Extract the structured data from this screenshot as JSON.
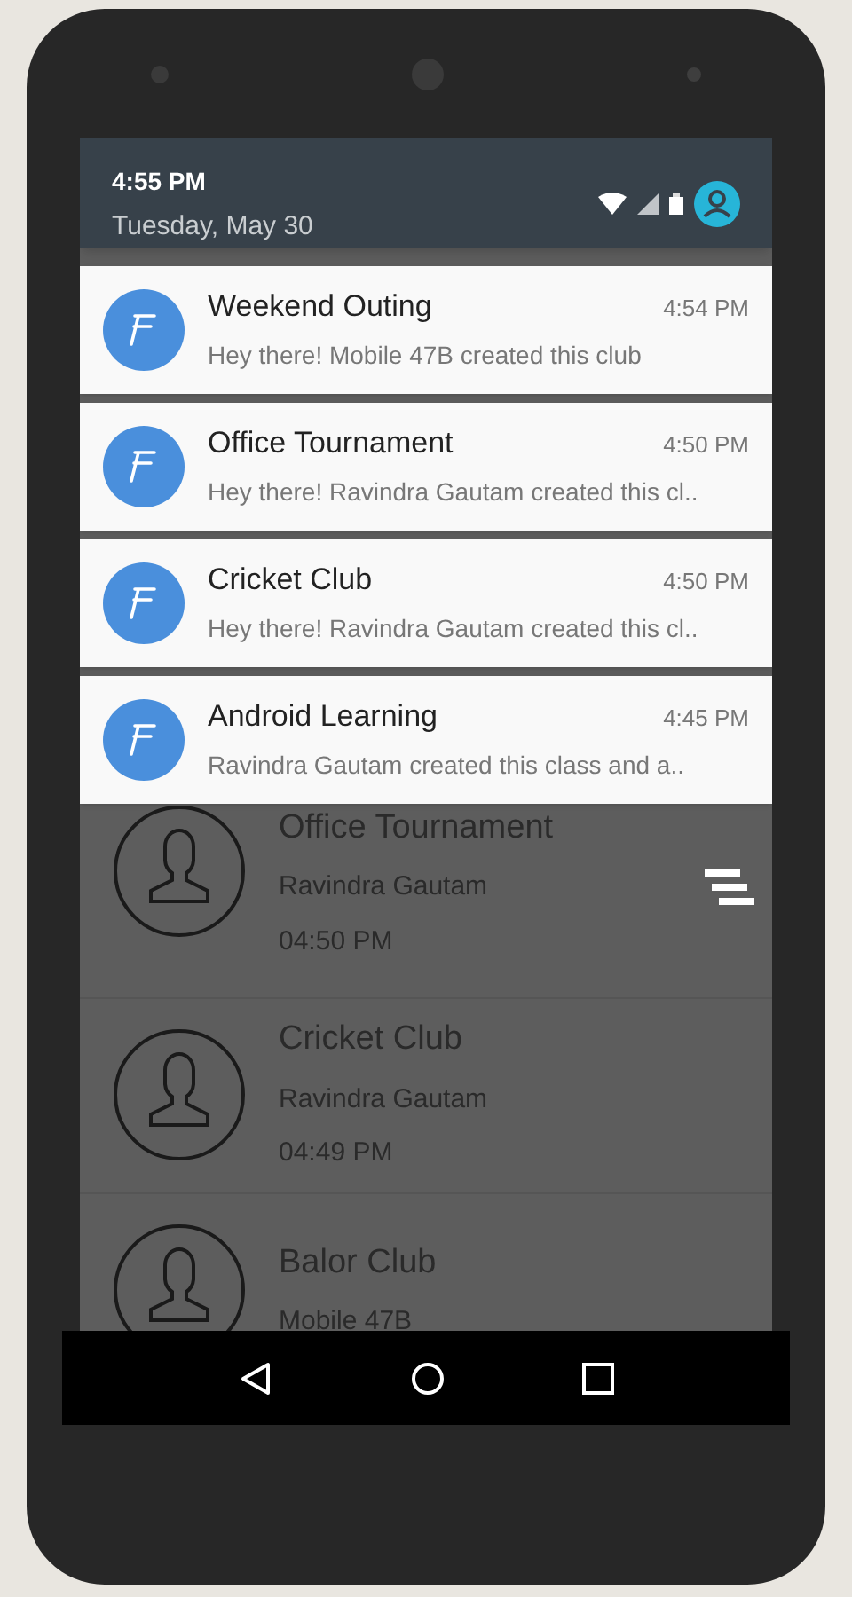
{
  "status": {
    "time": "4:55 PM",
    "date": "Tuesday, May 30"
  },
  "notifications": [
    {
      "title": "Weekend Outing",
      "time": "4:54 PM",
      "body": "Hey there! Mobile 47B created this club"
    },
    {
      "title": "Office Tournament",
      "time": "4:50 PM",
      "body": "Hey there! Ravindra Gautam created this cl.."
    },
    {
      "title": "Cricket Club",
      "time": "4:50 PM",
      "body": "Hey there! Ravindra Gautam created this cl.."
    },
    {
      "title": "Android Learning",
      "time": "4:45 PM",
      "body": "Ravindra Gautam created this class and a.."
    }
  ],
  "list": [
    {
      "title": "Office Tournament",
      "subtitle": "Ravindra Gautam",
      "time": "04:50 PM"
    },
    {
      "title": "Cricket Club",
      "subtitle": "Ravindra Gautam",
      "time": "04:49 PM"
    },
    {
      "title": "Balor Club",
      "subtitle": "Mobile 47B"
    }
  ]
}
